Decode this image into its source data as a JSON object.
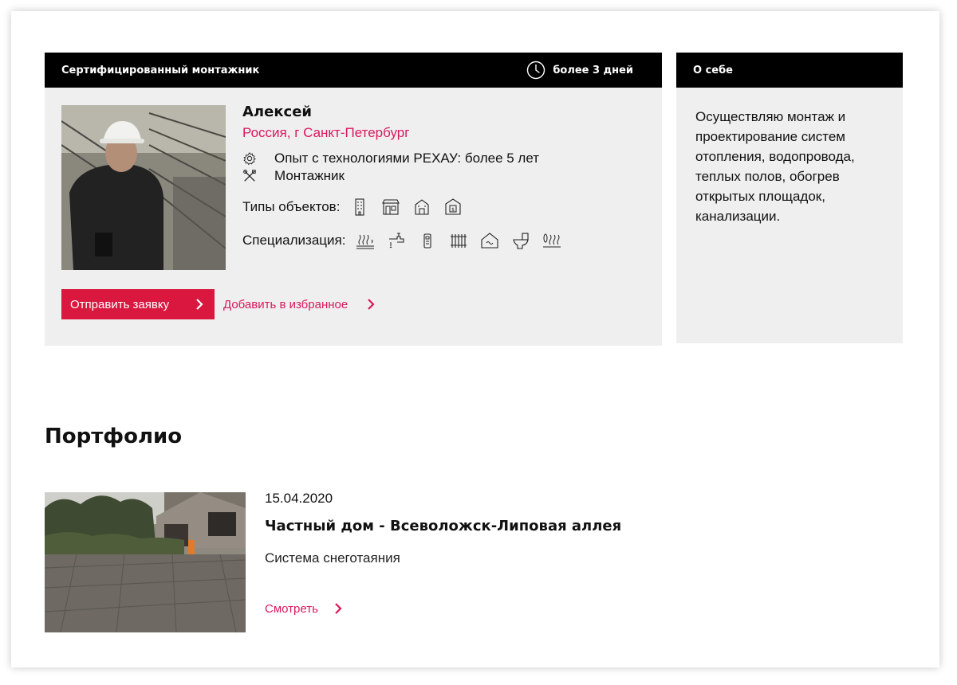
{
  "installer_card": {
    "header_title": "Сертифицированный монтажник",
    "response_time": "более 3 дней",
    "name": "Алексей",
    "location": "Россия, г Санкт-Петербург",
    "experience": "Опыт с технологиями РЕХАУ: более 5 лет",
    "role": "Монтажник",
    "object_types_label": "Типы объектов:",
    "object_types_icons": [
      "apartment-building-icon",
      "shop-icon",
      "house-icon",
      "bank-icon"
    ],
    "specialization_label": "Специализация:",
    "specialization_icons": [
      "floor-heating-icon",
      "water-tap-icon",
      "thermostat-icon",
      "radiator-icon",
      "house-heating-icon",
      "toilet-icon",
      "snow-melting-icon"
    ],
    "primary_button": "Отправить заявку",
    "favorite_link": "Добавить в избранное"
  },
  "about": {
    "header_title": "О себе",
    "text": "Осуществляю монтаж и проектирование систем отопления, водопровода, теплых полов, обогрев открытых площадок, канализации."
  },
  "portfolio": {
    "title": "Портфолио",
    "items": [
      {
        "date": "15.04.2020",
        "title": "Частный дом - Всеволожск-Липовая аллея",
        "system": "Система снеготаяния",
        "link": "Смотреть"
      }
    ]
  },
  "colors": {
    "accent": "#d9173f",
    "link": "#d9195c",
    "header_bg": "#000000",
    "card_bg": "#efefef"
  }
}
